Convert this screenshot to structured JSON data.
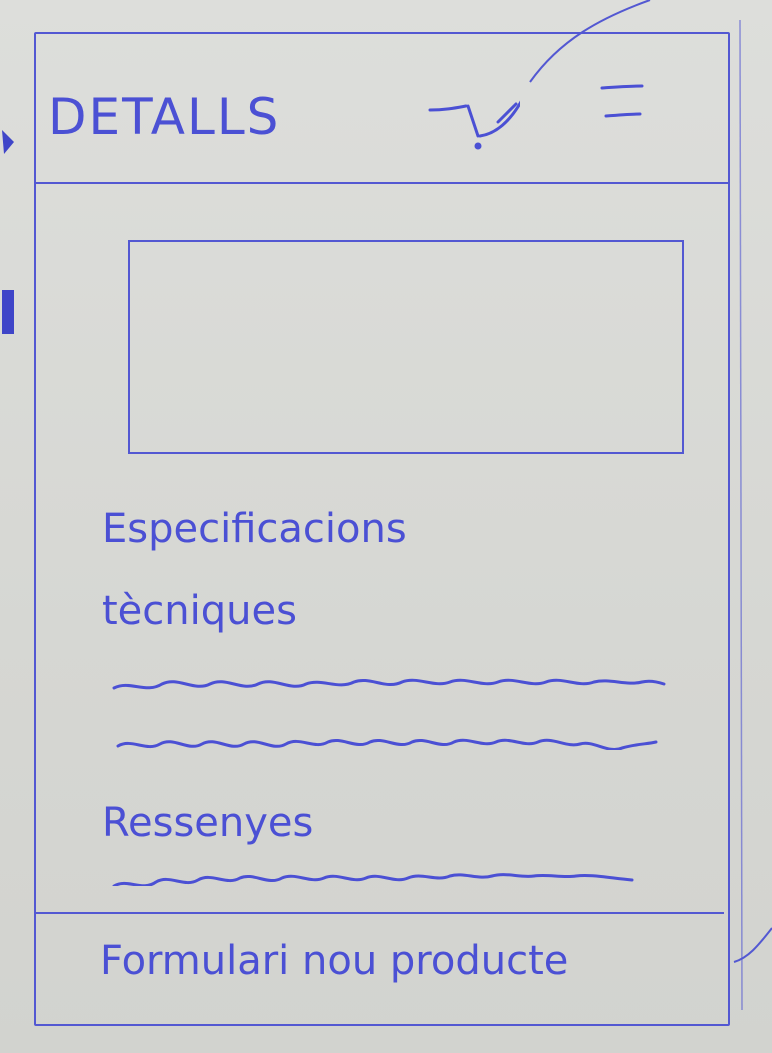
{
  "header": {
    "title": "DETALLS",
    "cart_icon": "shopping-cart-icon",
    "menu_icon": "hamburger-menu-icon"
  },
  "main": {
    "image_placeholder": "image-placeholder",
    "specs_heading_line1": "Especificacions",
    "specs_heading_line2": "tècniques",
    "reviews_heading": "Ressenyes"
  },
  "footer": {
    "label": "Formulari nou producte"
  },
  "colors": {
    "ink": "#4b50d4",
    "paper": "#d9dad6"
  }
}
